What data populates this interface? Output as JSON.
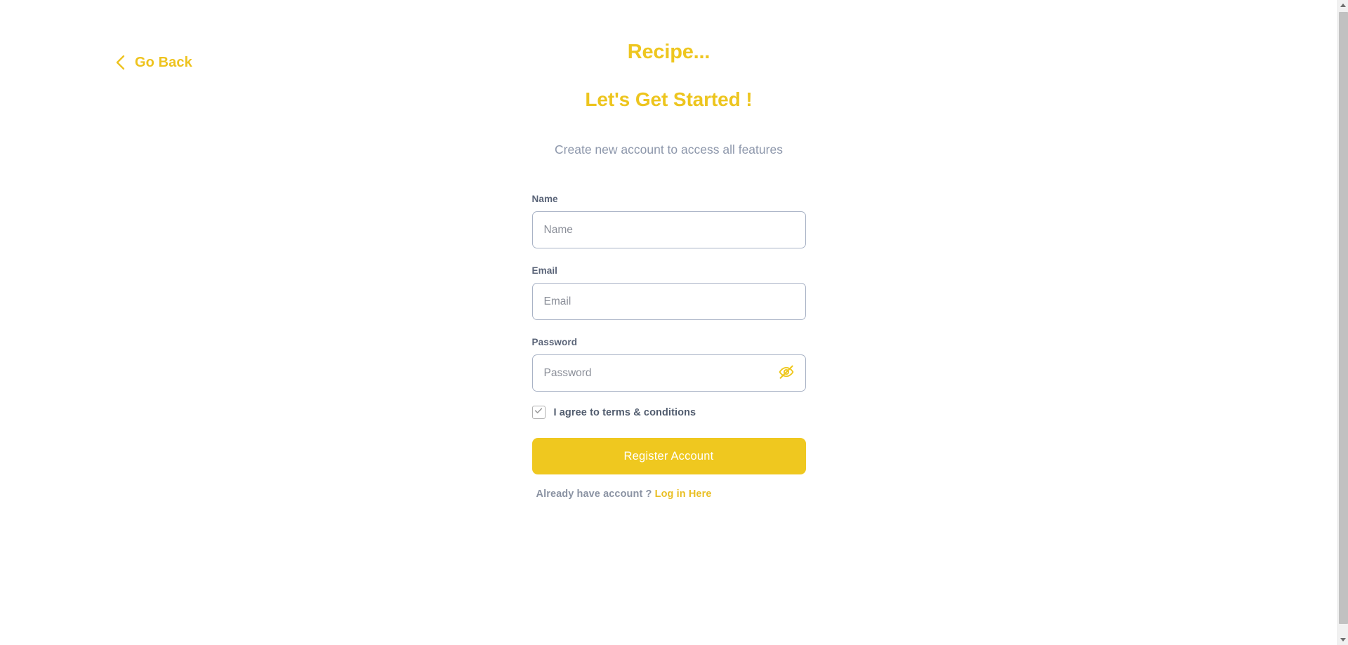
{
  "app": {
    "title": "Recipe..."
  },
  "nav": {
    "back_label": "Go Back",
    "back_icon": "chevron-left-icon"
  },
  "hero": {
    "headline": "Let's Get Started !",
    "subtitle": "Create new account to access all features"
  },
  "form": {
    "fields": [
      {
        "id": "name",
        "label": "Name",
        "placeholder": "Name",
        "value": "",
        "type": "text"
      },
      {
        "id": "email",
        "label": "Email",
        "placeholder": "Email",
        "value": "",
        "type": "text"
      },
      {
        "id": "password",
        "label": "Password",
        "placeholder": "Password",
        "value": "",
        "type": "password",
        "toggle_icon": "eye-off-icon"
      }
    ],
    "terms": {
      "label": "I agree to terms & conditions",
      "checked": true,
      "check_icon": "checkmark-icon"
    },
    "submit_label": "Register Account",
    "footer": {
      "prompt": "Already have account ?",
      "link_label": "Log in Here"
    }
  },
  "colors": {
    "brand_yellow": "#efc81f",
    "title_yellow": "#eec61f",
    "link_yellow": "#e9bf24",
    "subtitle_gray": "#8d97ab",
    "label_gray": "#5a6478",
    "placeholder_gray": "#8b8f99",
    "input_border": "#a9b3c6",
    "checkbox_border": "#b0b0b0",
    "button_text": "#ffffff",
    "page_background": "#ffffff"
  },
  "scrollbar": {
    "up_icon": "arrow-up-icon",
    "down_icon": "arrow-down-icon"
  }
}
